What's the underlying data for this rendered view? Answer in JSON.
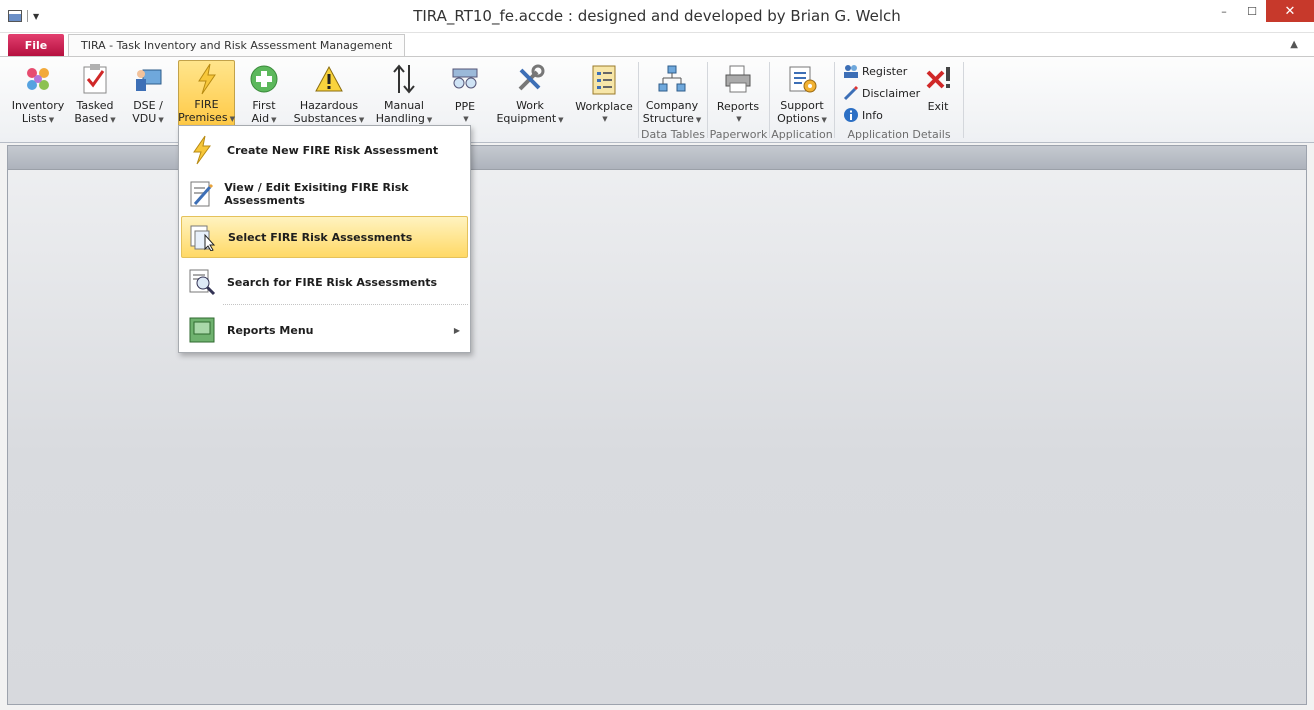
{
  "window": {
    "title": "TIRA_RT10_fe.accde : designed and developed by Brian G. Welch"
  },
  "window_controls": {
    "minimize": "–",
    "maximize": "☐",
    "close": "✕"
  },
  "tabs": {
    "file": "File",
    "main": "TIRA - Task Inventory and Risk Assessment Management"
  },
  "ribbon_buttons": [
    {
      "l1": "Inventory",
      "l2": "Lists"
    },
    {
      "l1": "Tasked",
      "l2": "Based"
    },
    {
      "l1": "DSE /",
      "l2": "VDU"
    },
    {
      "l1": "FIRE",
      "l2": "Premises"
    },
    {
      "l1": "First",
      "l2": "Aid"
    },
    {
      "l1": "Hazardous",
      "l2": "Substances"
    },
    {
      "l1": "Manual",
      "l2": "Handling"
    },
    {
      "l1": "PPE",
      "l2": ""
    },
    {
      "l1": "Work",
      "l2": "Equipment"
    },
    {
      "l1": "Workplace",
      "l2": ""
    },
    {
      "l1": "Company",
      "l2": "Structure"
    },
    {
      "l1": "Reports",
      "l2": ""
    },
    {
      "l1": "Support",
      "l2": "Options"
    },
    {
      "l1": "Exit",
      "l2": ""
    }
  ],
  "small_buttons": [
    "Register",
    "Disclaimer",
    "Info"
  ],
  "groups": {
    "data_tables": "Data Tables",
    "paperwork": "Paperwork",
    "application": "Application",
    "application_details": "Application Details"
  },
  "menu": {
    "items": [
      "Create New FIRE Risk Assessment",
      "View / Edit Exisiting FIRE Risk Assessments",
      "Select FIRE Risk Assessments",
      "Search for FIRE Risk Assessments",
      "Reports Menu"
    ],
    "highlighted_index": 2
  }
}
